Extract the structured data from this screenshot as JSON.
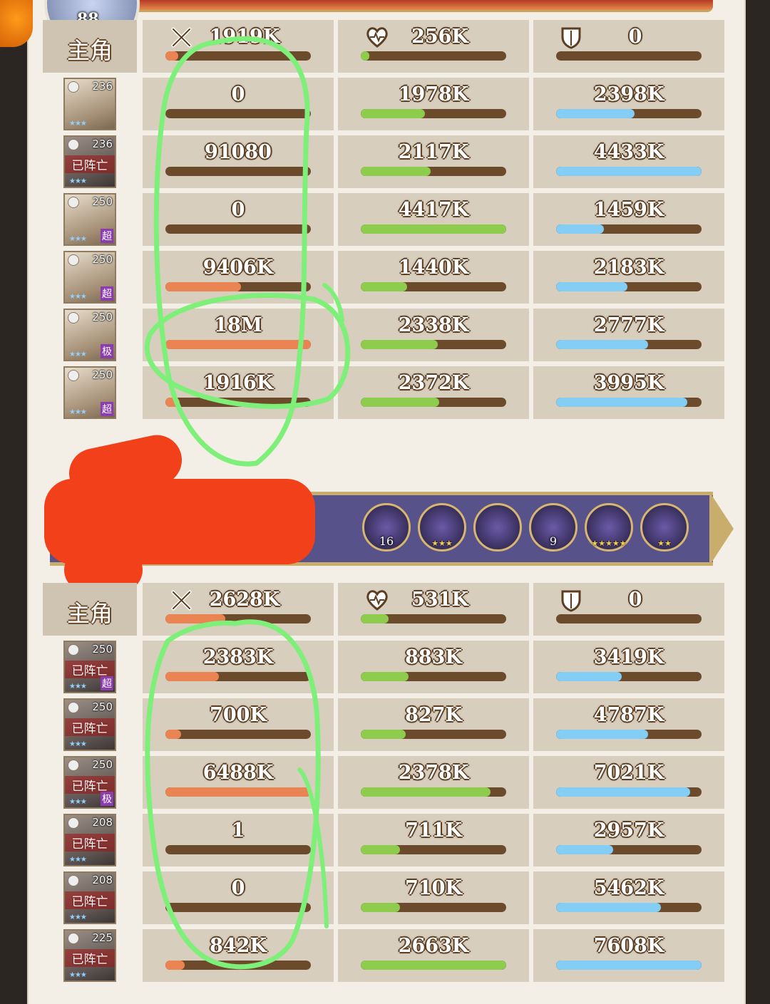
{
  "player": {
    "level": "88"
  },
  "section1": {
    "label_row": {
      "role": "主角",
      "damage": "1919K",
      "damage_pct": 0.09,
      "heal": "256K",
      "heal_pct": 0.03,
      "shield": "0",
      "shield_pct": 0.0
    },
    "heroes": [
      {
        "level": "236",
        "dead": false,
        "grade": "",
        "dead_text": "",
        "damage": "0",
        "damage_pct": 0.0,
        "heal": "1978K",
        "heal_pct": 0.44,
        "shield": "2398K",
        "shield_pct": 0.54
      },
      {
        "level": "236",
        "dead": true,
        "grade": "",
        "dead_text": "已阵亡",
        "damage": "91080",
        "damage_pct": 0.0,
        "heal": "2117K",
        "heal_pct": 0.48,
        "shield": "4433K",
        "shield_pct": 1.0
      },
      {
        "level": "250",
        "dead": false,
        "grade": "超",
        "dead_text": "",
        "damage": "0",
        "damage_pct": 0.0,
        "heal": "4417K",
        "heal_pct": 1.0,
        "shield": "1459K",
        "shield_pct": 0.33
      },
      {
        "level": "250",
        "dead": false,
        "grade": "超",
        "dead_text": "",
        "damage": "9406K",
        "damage_pct": 0.52,
        "heal": "1440K",
        "heal_pct": 0.32,
        "shield": "2183K",
        "shield_pct": 0.49
      },
      {
        "level": "250",
        "dead": false,
        "grade": "极",
        "dead_text": "",
        "damage": "18M",
        "damage_pct": 1.0,
        "heal": "2338K",
        "heal_pct": 0.53,
        "shield": "2777K",
        "shield_pct": 0.63
      },
      {
        "level": "250",
        "dead": false,
        "grade": "超",
        "dead_text": "",
        "damage": "1916K",
        "damage_pct": 0.1,
        "heal": "2372K",
        "heal_pct": 0.54,
        "shield": "3995K",
        "shield_pct": 0.9
      }
    ]
  },
  "artifacts": [
    {
      "badge": "16",
      "stars": ""
    },
    {
      "badge": "",
      "stars": "★★★"
    },
    {
      "badge": "",
      "stars": ""
    },
    {
      "badge": "9",
      "stars": ""
    },
    {
      "badge": "",
      "stars": "★★★★★"
    },
    {
      "badge": "",
      "stars": "★★"
    }
  ],
  "section2": {
    "label_row": {
      "role": "主角",
      "damage": "2628K",
      "damage_pct": 0.41,
      "heal": "531K",
      "heal_pct": 0.19,
      "shield": "0",
      "shield_pct": 0.0
    },
    "heroes": [
      {
        "level": "250",
        "dead": true,
        "grade": "超",
        "dead_text": "已阵亡",
        "damage": "2383K",
        "damage_pct": 0.37,
        "heal": "883K",
        "heal_pct": 0.33,
        "shield": "3419K",
        "shield_pct": 0.45
      },
      {
        "level": "250",
        "dead": true,
        "grade": "",
        "dead_text": "已阵亡",
        "damage": "700K",
        "damage_pct": 0.11,
        "heal": "827K",
        "heal_pct": 0.31,
        "shield": "4787K",
        "shield_pct": 0.63
      },
      {
        "level": "250",
        "dead": true,
        "grade": "极",
        "dead_text": "已阵亡",
        "damage": "6488K",
        "damage_pct": 1.0,
        "heal": "2378K",
        "heal_pct": 0.89,
        "shield": "7021K",
        "shield_pct": 0.92
      },
      {
        "level": "208",
        "dead": true,
        "grade": "",
        "dead_text": "已阵亡",
        "damage": "1",
        "damage_pct": 0.0,
        "heal": "711K",
        "heal_pct": 0.27,
        "shield": "2957K",
        "shield_pct": 0.39
      },
      {
        "level": "208",
        "dead": true,
        "grade": "",
        "dead_text": "已阵亡",
        "damage": "0",
        "damage_pct": 0.0,
        "heal": "710K",
        "heal_pct": 0.27,
        "shield": "5462K",
        "shield_pct": 0.72
      },
      {
        "level": "225",
        "dead": true,
        "grade": "",
        "dead_text": "已阵亡",
        "damage": "842K",
        "damage_pct": 0.13,
        "heal": "2663K",
        "heal_pct": 1.0,
        "shield": "7608K",
        "shield_pct": 1.0
      }
    ]
  },
  "colors": {
    "damage": "#ea8553",
    "heal": "#8dcc4c",
    "shield": "#84cdf5",
    "bar_track": "#6c4b2d",
    "annotation_green": "#7ef07a",
    "redaction_red": "#f2401b"
  },
  "icons": {
    "damage": "crossed-swords-icon",
    "heal": "heart-icon",
    "shield": "shield-icon"
  }
}
